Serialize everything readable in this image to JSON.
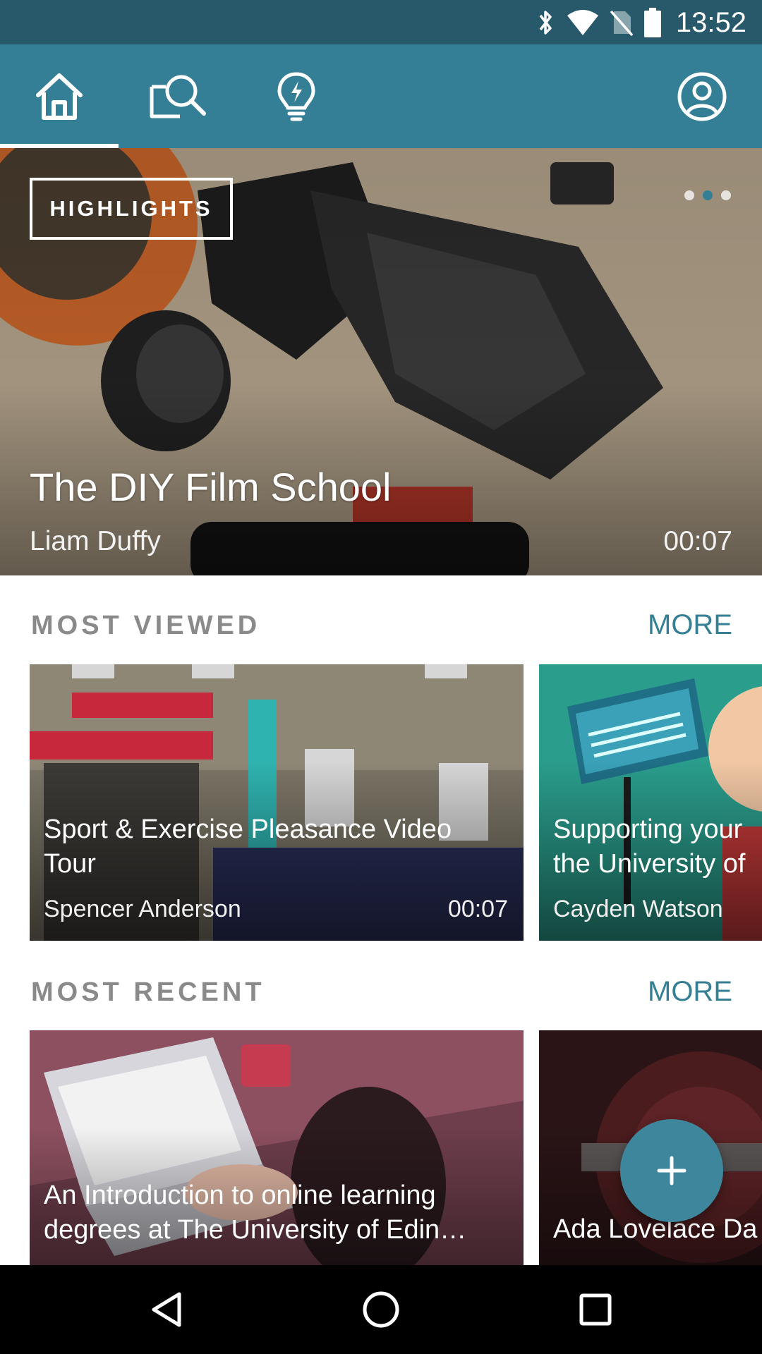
{
  "status_bar": {
    "time": "13:52",
    "icons": [
      "bluetooth-icon",
      "wifi-icon",
      "no-sim-icon",
      "battery-icon"
    ]
  },
  "app_bar": {
    "tabs": [
      {
        "name": "home",
        "icon": "home-icon",
        "active": true
      },
      {
        "name": "search",
        "icon": "search-icon",
        "active": false
      },
      {
        "name": "ideas",
        "icon": "lightbulb-icon",
        "active": false
      }
    ],
    "profile_icon": "account-circle-icon",
    "color": "#347f96"
  },
  "hero": {
    "badge": "HIGHLIGHTS",
    "title": "The DIY Film School",
    "author": "Liam Duffy",
    "duration": "00:07",
    "slide_count": 3,
    "active_slide": 2
  },
  "sections": {
    "most_viewed": {
      "title": "MOST VIEWED",
      "more": "MORE",
      "cards": [
        {
          "title": "Sport & Exercise Pleasance Video Tour",
          "author": "Spencer Anderson",
          "duration": "00:07"
        },
        {
          "title": "Supporting your",
          "title_line2": "the University of",
          "author": "Cayden Watson",
          "duration": ""
        }
      ]
    },
    "most_recent": {
      "title": "MOST RECENT",
      "more": "MORE",
      "cards": [
        {
          "title": "An Introduction to online learning degrees at The University of Edin…",
          "author": "",
          "duration": ""
        },
        {
          "title": "Ada Lovelace Da",
          "author": "",
          "duration": ""
        }
      ]
    }
  },
  "fab": {
    "icon": "plus-icon",
    "label": "+"
  },
  "system_nav": {
    "icons": [
      "back-icon",
      "home-circle-icon",
      "recents-icon"
    ]
  }
}
